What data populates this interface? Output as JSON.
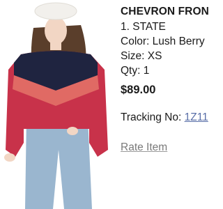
{
  "product": {
    "name": "CHEVRON FRON",
    "variant_line": "1. STATE",
    "color_line": "Color: Lush Berry",
    "size_line": "Size: XS",
    "qty_line": "Qty: 1",
    "price": "$89.00"
  },
  "shipping": {
    "tracking_label": "Tracking No:",
    "tracking_number": "1Z11"
  },
  "actions": {
    "rate_item": "Rate Item"
  },
  "image": {
    "subject": "model wearing red chevron sweater with white beret and jeans",
    "colors": {
      "navy": "#1f2440",
      "coral": "#e06a64",
      "berry": "#c8324a",
      "denim": "#9ab6cf",
      "beret": "#f2f0ec",
      "hair": "#5a3e2b",
      "skin": "#f2d6c4"
    }
  }
}
